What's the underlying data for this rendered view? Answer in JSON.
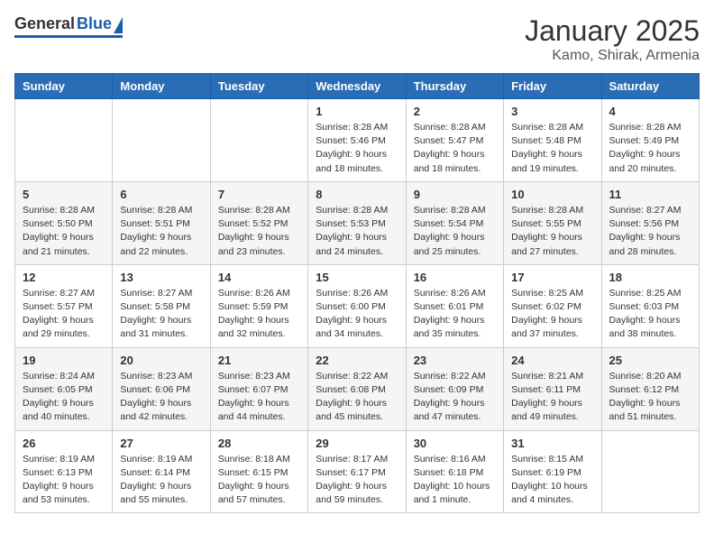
{
  "header": {
    "logo_general": "General",
    "logo_blue": "Blue",
    "title": "January 2025",
    "subtitle": "Kamo, Shirak, Armenia"
  },
  "weekdays": [
    "Sunday",
    "Monday",
    "Tuesday",
    "Wednesday",
    "Thursday",
    "Friday",
    "Saturday"
  ],
  "weeks": [
    [
      {
        "day": "",
        "info": ""
      },
      {
        "day": "",
        "info": ""
      },
      {
        "day": "",
        "info": ""
      },
      {
        "day": "1",
        "info": "Sunrise: 8:28 AM\nSunset: 5:46 PM\nDaylight: 9 hours\nand 18 minutes."
      },
      {
        "day": "2",
        "info": "Sunrise: 8:28 AM\nSunset: 5:47 PM\nDaylight: 9 hours\nand 18 minutes."
      },
      {
        "day": "3",
        "info": "Sunrise: 8:28 AM\nSunset: 5:48 PM\nDaylight: 9 hours\nand 19 minutes."
      },
      {
        "day": "4",
        "info": "Sunrise: 8:28 AM\nSunset: 5:49 PM\nDaylight: 9 hours\nand 20 minutes."
      }
    ],
    [
      {
        "day": "5",
        "info": "Sunrise: 8:28 AM\nSunset: 5:50 PM\nDaylight: 9 hours\nand 21 minutes."
      },
      {
        "day": "6",
        "info": "Sunrise: 8:28 AM\nSunset: 5:51 PM\nDaylight: 9 hours\nand 22 minutes."
      },
      {
        "day": "7",
        "info": "Sunrise: 8:28 AM\nSunset: 5:52 PM\nDaylight: 9 hours\nand 23 minutes."
      },
      {
        "day": "8",
        "info": "Sunrise: 8:28 AM\nSunset: 5:53 PM\nDaylight: 9 hours\nand 24 minutes."
      },
      {
        "day": "9",
        "info": "Sunrise: 8:28 AM\nSunset: 5:54 PM\nDaylight: 9 hours\nand 25 minutes."
      },
      {
        "day": "10",
        "info": "Sunrise: 8:28 AM\nSunset: 5:55 PM\nDaylight: 9 hours\nand 27 minutes."
      },
      {
        "day": "11",
        "info": "Sunrise: 8:27 AM\nSunset: 5:56 PM\nDaylight: 9 hours\nand 28 minutes."
      }
    ],
    [
      {
        "day": "12",
        "info": "Sunrise: 8:27 AM\nSunset: 5:57 PM\nDaylight: 9 hours\nand 29 minutes."
      },
      {
        "day": "13",
        "info": "Sunrise: 8:27 AM\nSunset: 5:58 PM\nDaylight: 9 hours\nand 31 minutes."
      },
      {
        "day": "14",
        "info": "Sunrise: 8:26 AM\nSunset: 5:59 PM\nDaylight: 9 hours\nand 32 minutes."
      },
      {
        "day": "15",
        "info": "Sunrise: 8:26 AM\nSunset: 6:00 PM\nDaylight: 9 hours\nand 34 minutes."
      },
      {
        "day": "16",
        "info": "Sunrise: 8:26 AM\nSunset: 6:01 PM\nDaylight: 9 hours\nand 35 minutes."
      },
      {
        "day": "17",
        "info": "Sunrise: 8:25 AM\nSunset: 6:02 PM\nDaylight: 9 hours\nand 37 minutes."
      },
      {
        "day": "18",
        "info": "Sunrise: 8:25 AM\nSunset: 6:03 PM\nDaylight: 9 hours\nand 38 minutes."
      }
    ],
    [
      {
        "day": "19",
        "info": "Sunrise: 8:24 AM\nSunset: 6:05 PM\nDaylight: 9 hours\nand 40 minutes."
      },
      {
        "day": "20",
        "info": "Sunrise: 8:23 AM\nSunset: 6:06 PM\nDaylight: 9 hours\nand 42 minutes."
      },
      {
        "day": "21",
        "info": "Sunrise: 8:23 AM\nSunset: 6:07 PM\nDaylight: 9 hours\nand 44 minutes."
      },
      {
        "day": "22",
        "info": "Sunrise: 8:22 AM\nSunset: 6:08 PM\nDaylight: 9 hours\nand 45 minutes."
      },
      {
        "day": "23",
        "info": "Sunrise: 8:22 AM\nSunset: 6:09 PM\nDaylight: 9 hours\nand 47 minutes."
      },
      {
        "day": "24",
        "info": "Sunrise: 8:21 AM\nSunset: 6:11 PM\nDaylight: 9 hours\nand 49 minutes."
      },
      {
        "day": "25",
        "info": "Sunrise: 8:20 AM\nSunset: 6:12 PM\nDaylight: 9 hours\nand 51 minutes."
      }
    ],
    [
      {
        "day": "26",
        "info": "Sunrise: 8:19 AM\nSunset: 6:13 PM\nDaylight: 9 hours\nand 53 minutes."
      },
      {
        "day": "27",
        "info": "Sunrise: 8:19 AM\nSunset: 6:14 PM\nDaylight: 9 hours\nand 55 minutes."
      },
      {
        "day": "28",
        "info": "Sunrise: 8:18 AM\nSunset: 6:15 PM\nDaylight: 9 hours\nand 57 minutes."
      },
      {
        "day": "29",
        "info": "Sunrise: 8:17 AM\nSunset: 6:17 PM\nDaylight: 9 hours\nand 59 minutes."
      },
      {
        "day": "30",
        "info": "Sunrise: 8:16 AM\nSunset: 6:18 PM\nDaylight: 10 hours\nand 1 minute."
      },
      {
        "day": "31",
        "info": "Sunrise: 8:15 AM\nSunset: 6:19 PM\nDaylight: 10 hours\nand 4 minutes."
      },
      {
        "day": "",
        "info": ""
      }
    ]
  ]
}
